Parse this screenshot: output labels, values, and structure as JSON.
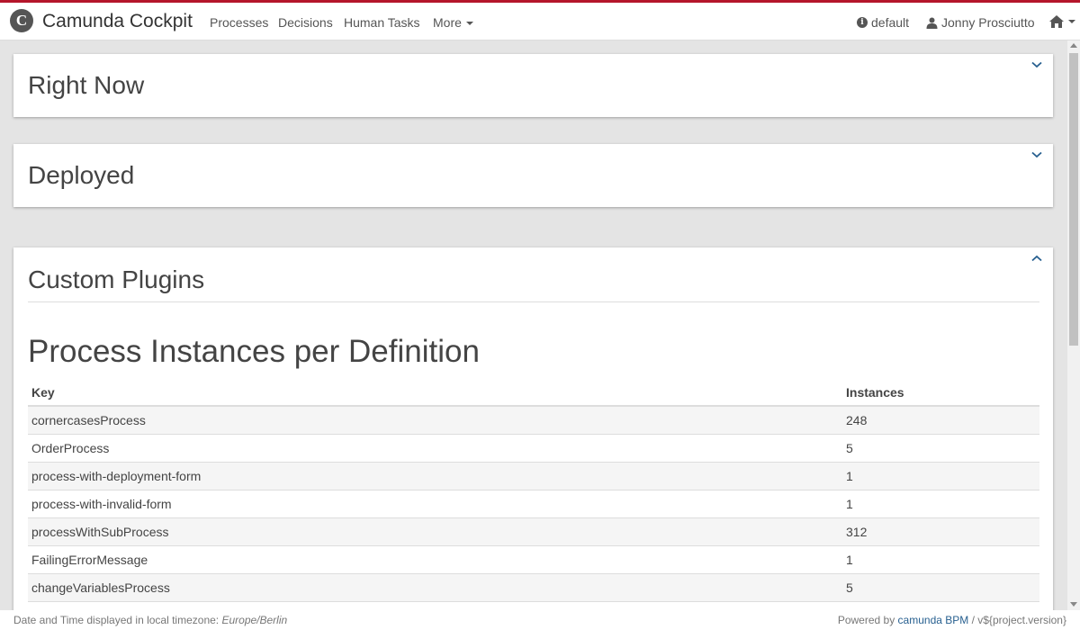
{
  "app": {
    "logo_letter": "C",
    "brand": "Camunda Cockpit",
    "accent_color": "#b5152b"
  },
  "nav": {
    "items": [
      "Processes",
      "Decisions",
      "Human Tasks",
      "More"
    ],
    "engine": "default",
    "user": "Jonny Prosciutto"
  },
  "panels": {
    "right_now": "Right Now",
    "deployed": "Deployed",
    "custom_plugins": "Custom Plugins"
  },
  "plugin": {
    "title": "Process Instances per Definition",
    "columns": [
      "Key",
      "Instances"
    ],
    "rows": [
      {
        "key": "cornercasesProcess",
        "instances": "248"
      },
      {
        "key": "OrderProcess",
        "instances": "5"
      },
      {
        "key": "process-with-deployment-form",
        "instances": "1"
      },
      {
        "key": "process-with-invalid-form",
        "instances": "1"
      },
      {
        "key": "processWithSubProcess",
        "instances": "312"
      },
      {
        "key": "FailingErrorMessage",
        "instances": "1"
      },
      {
        "key": "changeVariablesProcess",
        "instances": "5"
      }
    ]
  },
  "footer": {
    "timezone_label": "Date and Time displayed in local timezone:",
    "timezone": "Europe/Berlin",
    "powered_by": "Powered by",
    "bpm_link": "camunda BPM",
    "version": "/ v${project.version}"
  }
}
